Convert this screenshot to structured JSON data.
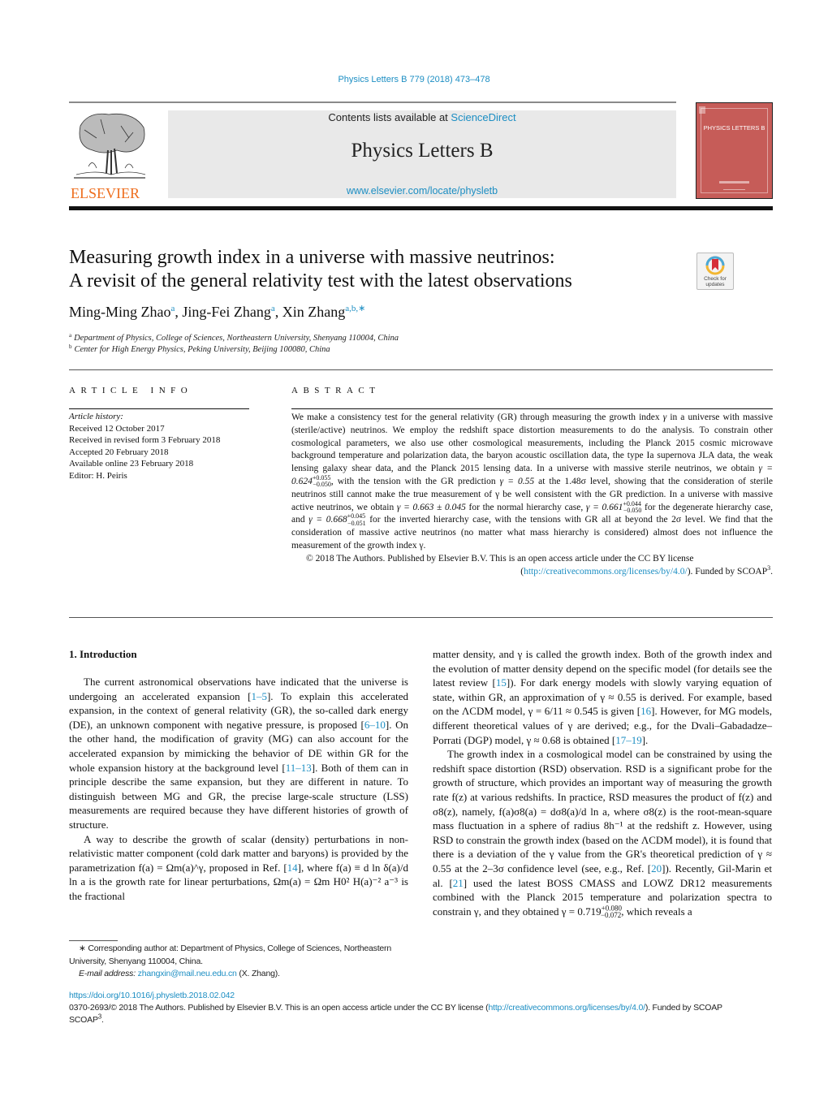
{
  "journal_ref": "Physics Letters B 779 (2018) 473–478",
  "header": {
    "publisher_logo_text": "ELSEVIER",
    "contents_prefix": "Contents lists available at ",
    "contents_link": "ScienceDirect",
    "journal_title": "Physics Letters B",
    "journal_url": "www.elsevier.com/locate/physletb",
    "cover_title": "PHYSICS LETTERS B"
  },
  "colors": {
    "link": "#1c8ec3",
    "elsevier_orange": "#ee6d1d",
    "cover": "#c65c58",
    "header_bg": "#e9e9e9"
  },
  "article": {
    "title_line1": "Measuring growth index in a universe with massive neutrinos:",
    "title_line2": "A revisit of the general relativity test with the latest observations",
    "crossmark_label_1": "Check for",
    "crossmark_label_2": "updates",
    "authors": [
      {
        "name": "Ming-Ming Zhao",
        "sup": "a"
      },
      {
        "name": "Jing-Fei Zhang",
        "sup": "a"
      },
      {
        "name": "Xin Zhang",
        "sup": "a,b,∗"
      }
    ],
    "affiliations": [
      {
        "mark": "a",
        "text": "Department of Physics, College of Sciences, Northeastern University, Shenyang 110004, China"
      },
      {
        "mark": "b",
        "text": "Center for High Energy Physics, Peking University, Beijing 100080, China"
      }
    ]
  },
  "article_info": {
    "heading": "ARTICLE INFO",
    "history_label": "Article history:",
    "items": [
      "Received 12 October 2017",
      "Received in revised form 3 February 2018",
      "Accepted 20 February 2018",
      "Available online 23 February 2018",
      "Editor: H. Peiris"
    ]
  },
  "abstract": {
    "heading": "ABSTRACT",
    "p1": "We make a consistency test for the general relativity (GR) through measuring the growth index",
    "p2": "in a universe with massive (sterile/active) neutrinos. We employ the redshift space distortion measurements to do the analysis. To constrain other cosmological parameters, we also use other cosmological measurements, including the Planck 2015 cosmic microwave background temperature and polarization data, the baryon acoustic oscillation data, the type Ia supernova JLA data, the weak lensing galaxy shear data, and the Planck 2015 lensing data. In a universe with massive sterile neutrinos, we obtain ",
    "g1": "γ = 0.624",
    "g1_up": "+0.055",
    "g1_dn": "−0.050",
    "p3": ", with the tension with the GR prediction ",
    "g_gr": "γ = 0.55",
    "p4": " at the 1.48σ level, showing that the consideration of sterile neutrinos still cannot make the true measurement of γ be well consistent with the GR prediction. In a universe with massive active neutrinos, we obtain ",
    "g2": "γ = 0.663 ± 0.045",
    "p5": " for the normal hierarchy case, ",
    "g3": "γ = 0.661",
    "g3_up": "+0.044",
    "g3_dn": "−0.050",
    "p6": " for the degenerate hierarchy case, and ",
    "g4": "γ = 0.668",
    "g4_up": "+0.045",
    "g4_dn": "−0.051",
    "p7": " for the inverted hierarchy case, with the tensions with GR all at beyond the 2σ level. We find that the consideration of massive active neutrinos (no matter what mass hierarchy is considered) almost does not influence the measurement of the growth index γ.",
    "copyright": "© 2018 The Authors. Published by Elsevier B.V. This is an open access article under the CC BY license",
    "license_link": "http://creativecommons.org/licenses/by/4.0/",
    "funded": ". Funded by SCOAP",
    "funded_sup": "3"
  },
  "section1": {
    "heading": "1. Introduction",
    "left_p1": [
      "The current astronomical observations have indicated that the universe is undergoing an accelerated expansion [",
      "1–5",
      "]. To explain this accelerated expansion, in the context of general relativity (GR), the so-called dark energy (DE), an unknown component with negative pressure, is proposed [",
      "6–10",
      "]. On the other hand, the modification of gravity (MG) can also account for the accelerated expansion by mimicking the behavior of DE within GR for the whole expansion history at the background level [",
      "11–13",
      "]. Both of them can in principle describe the same expansion, but they are different in nature. To distinguish between MG and GR, the precise large-scale structure (LSS) measurements are required because they have different histories of growth of structure."
    ],
    "left_p2": [
      "A way to describe the growth of scalar (density) perturbations in non-relativistic matter component (cold dark matter and baryons) is provided by the parametrization f(a) = Ωm(a)^γ, proposed in Ref. [",
      "14",
      "], where f(a) ≡ d ln δ(a)/d ln a is the growth rate for linear perturbations, Ωm(a) = Ωm H0² H(a)⁻² a⁻³ is the fractional"
    ],
    "right_p1": [
      "matter density, and γ is called the growth index. Both of the growth index and the evolution of matter density depend on the specific model (for details see the latest review [",
      "15",
      "]). For dark energy models with slowly varying equation of state, within GR, an approximation of γ ≈ 0.55 is derived. For example, based on the ΛCDM model, γ = 6/11 ≈ 0.545 is given [",
      "16",
      "]. However, for MG models, different theoretical values of γ are derived; e.g., for the Dvali–Gabadadze–Porrati (DGP) model, γ ≈ 0.68 is obtained [",
      "17–19",
      "]."
    ],
    "right_p2": [
      "The growth index in a cosmological model can be constrained by using the redshift space distortion (RSD) observation. RSD is a significant probe for the growth of structure, which provides an important way of measuring the growth rate f(z) at various redshifts. In practice, RSD measures the product of f(z) and σ8(z), namely, f(a)σ8(a) = dσ8(a)/d ln a, where σ8(z) is the root-mean-square mass fluctuation in a sphere of radius 8h⁻¹ at the redshift z. However, using RSD to constrain the growth index (based on the ΛCDM model), it is found that there is a deviation of the γ value from the GR's theoretical prediction of γ ≈ 0.55 at the 2–3σ confidence level (see, e.g., Ref. [",
      "20",
      "]). Recently, Gil-Marin et al. [",
      "21",
      "] used the latest BOSS CMASS and LOWZ DR12 measurements combined with the Planck 2015 temperature and polarization spectra to constrain γ, and they obtained γ = 0.719",
      "+0.080",
      "−0.072",
      ", which reveals a"
    ]
  },
  "footnote": {
    "star": "∗",
    "corresponding": "Corresponding author at: Department of Physics, College of Sciences, Northeastern University, Shenyang 110004, China.",
    "email_label": "E-mail address:",
    "email": "zhangxin@mail.neu.edu.cn",
    "email_suffix": " (X. Zhang)."
  },
  "bottom": {
    "doi": "https://doi.org/10.1016/j.physletb.2018.02.042",
    "issn_text": "0370-2693/© 2018 The Authors. Published by Elsevier B.V. This is an open access article under the CC BY license (",
    "license_link": "http://creativecommons.org/licenses/by/4.0/",
    "funded": "). Funded by SCOAP",
    "funded_sup": "3",
    "end": "."
  }
}
